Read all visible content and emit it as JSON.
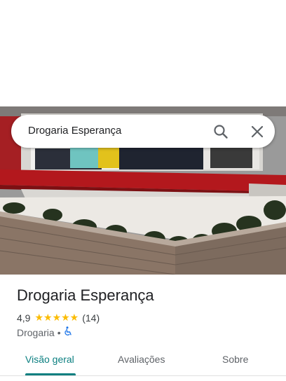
{
  "search": {
    "query": "Drogaria Esperança"
  },
  "place": {
    "name": "Drogaria Esperança",
    "rating": "4,9",
    "stars": "★★★★★",
    "reviews": "(14)",
    "category": "Drogaria",
    "separator": "•"
  },
  "tabs": [
    {
      "label": "Visão geral"
    },
    {
      "label": "Avaliações"
    },
    {
      "label": "Sobre"
    }
  ],
  "colors": {
    "accent": "#0b7f80",
    "stars": "#fbbc04",
    "accessible": "#1a73e8"
  },
  "icons": {
    "search": "search-icon",
    "close": "close-icon",
    "accessible": "wheelchair-icon"
  }
}
